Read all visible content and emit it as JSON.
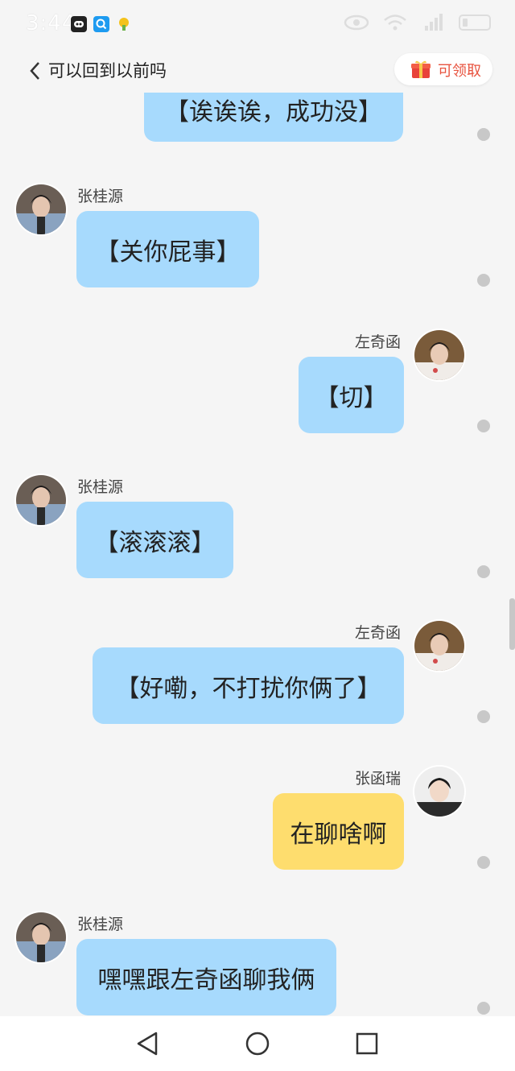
{
  "status_bar": {
    "time": "3:44",
    "apps": [
      "notification-app-icon",
      "search-app-icon",
      "weather-app-icon"
    ],
    "indicators": [
      "eye-icon",
      "wifi-icon",
      "signal-icon",
      "battery-icon"
    ]
  },
  "header": {
    "title": "可以回到以前吗",
    "reward_label": "可领取",
    "accent_color": "#e8533f"
  },
  "messages": [
    {
      "side": "right",
      "sender": "",
      "text": "【诶诶诶，成功没】",
      "color": "#a7dafd"
    },
    {
      "side": "left",
      "sender": "张桂源",
      "text": "【关你屁事】",
      "color": "#a7dafd"
    },
    {
      "side": "right",
      "sender": "左奇函",
      "text": "【切】",
      "color": "#a7dafd"
    },
    {
      "side": "left",
      "sender": "张桂源",
      "text": "【滚滚滚】",
      "color": "#a7dafd"
    },
    {
      "side": "right",
      "sender": "左奇函",
      "text": "【好嘞，不打扰你俩了】",
      "color": "#a7dafd"
    },
    {
      "side": "right",
      "sender": "张函瑞",
      "text": "在聊啥啊",
      "color": "#fedd6e"
    },
    {
      "side": "left",
      "sender": "张桂源",
      "text": "嘿嘿跟左奇函聊我俩",
      "color": "#a7dafd"
    }
  ],
  "nav_bar": [
    "back-triangle-icon",
    "home-circle-icon",
    "recents-square-icon"
  ]
}
